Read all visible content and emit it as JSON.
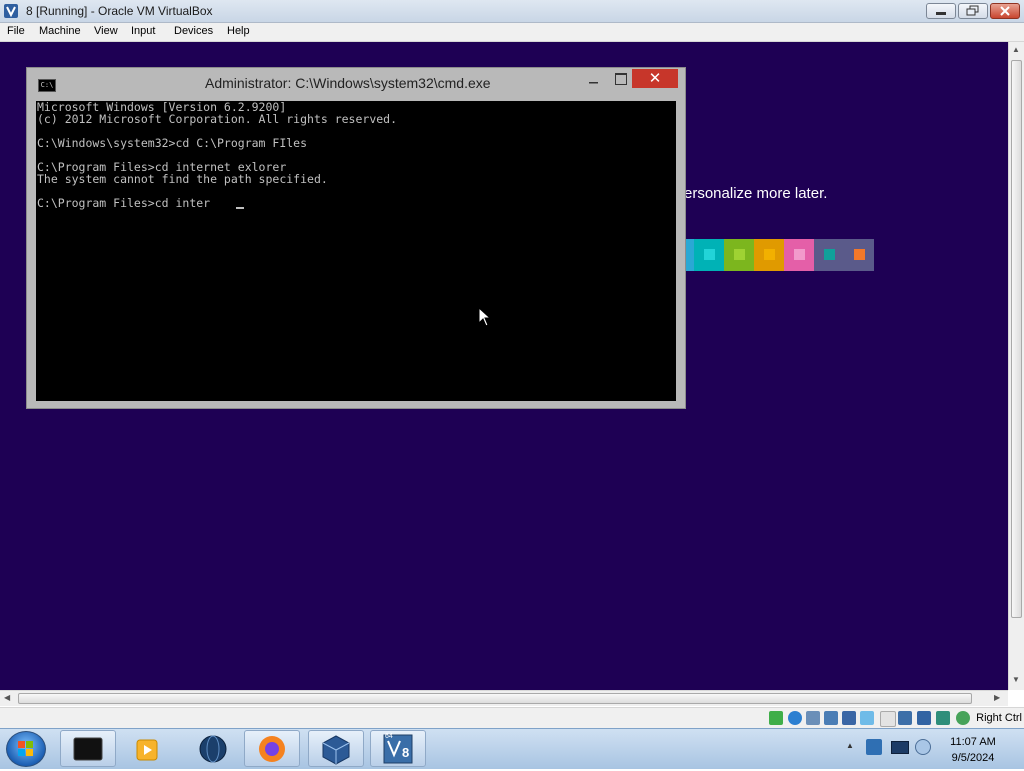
{
  "window": {
    "title": "8 [Running] - Oracle VM VirtualBox"
  },
  "menu": [
    "File",
    "Machine",
    "View",
    "Input",
    "Devices",
    "Help"
  ],
  "guest": {
    "background": "#1e0054",
    "personalize_text": "ersonalize more later.",
    "swatches": [
      {
        "bg": "#2aa8d4",
        "fg": "#2aa8d4"
      },
      {
        "bg": "#00b2b6",
        "fg": "#22d4d8"
      },
      {
        "bg": "#7cb61e",
        "fg": "#9fd233"
      },
      {
        "bg": "#e09a00",
        "fg": "#f2b000"
      },
      {
        "bg": "#e45fa8",
        "fg": "#f29acb"
      },
      {
        "bg": "#5a5a8a",
        "fg": "#10a09a"
      },
      {
        "bg": "#5a5a8a",
        "fg": "#f2782a"
      }
    ]
  },
  "cmd": {
    "title": "Administrator: C:\\Windows\\system32\\cmd.exe",
    "icon_label": "C:\\",
    "close_label": "✕",
    "lines": [
      "Microsoft Windows [Version 6.2.9200]",
      "(c) 2012 Microsoft Corporation. All rights reserved.",
      "",
      "C:\\Windows\\system32>cd C:\\Program FIles",
      "",
      "C:\\Program Files>cd internet exlorer",
      "The system cannot find the path specified.",
      "",
      "C:\\Program Files>cd inter"
    ]
  },
  "statusbar": {
    "host_key": "Right Ctrl",
    "icons": [
      "hdd-icon",
      "optical-icon",
      "audio-icon",
      "network-icon",
      "usb-icon",
      "shared-folder-icon",
      "display-icon",
      "video-capture-icon",
      "recording-icon",
      "cpu-icon",
      "mouse-integration-icon",
      "host-key-icon"
    ]
  },
  "taskbar": {
    "time": "11:07 AM",
    "date": "9/5/2024",
    "apps": [
      "terminal-app-icon",
      "media-player-icon",
      "globe-icon",
      "firefox-icon",
      "virtualbox-icon",
      "virtualbox-vm-icon"
    ],
    "vm_badge_top": "64",
    "vm_badge_num": "8"
  }
}
